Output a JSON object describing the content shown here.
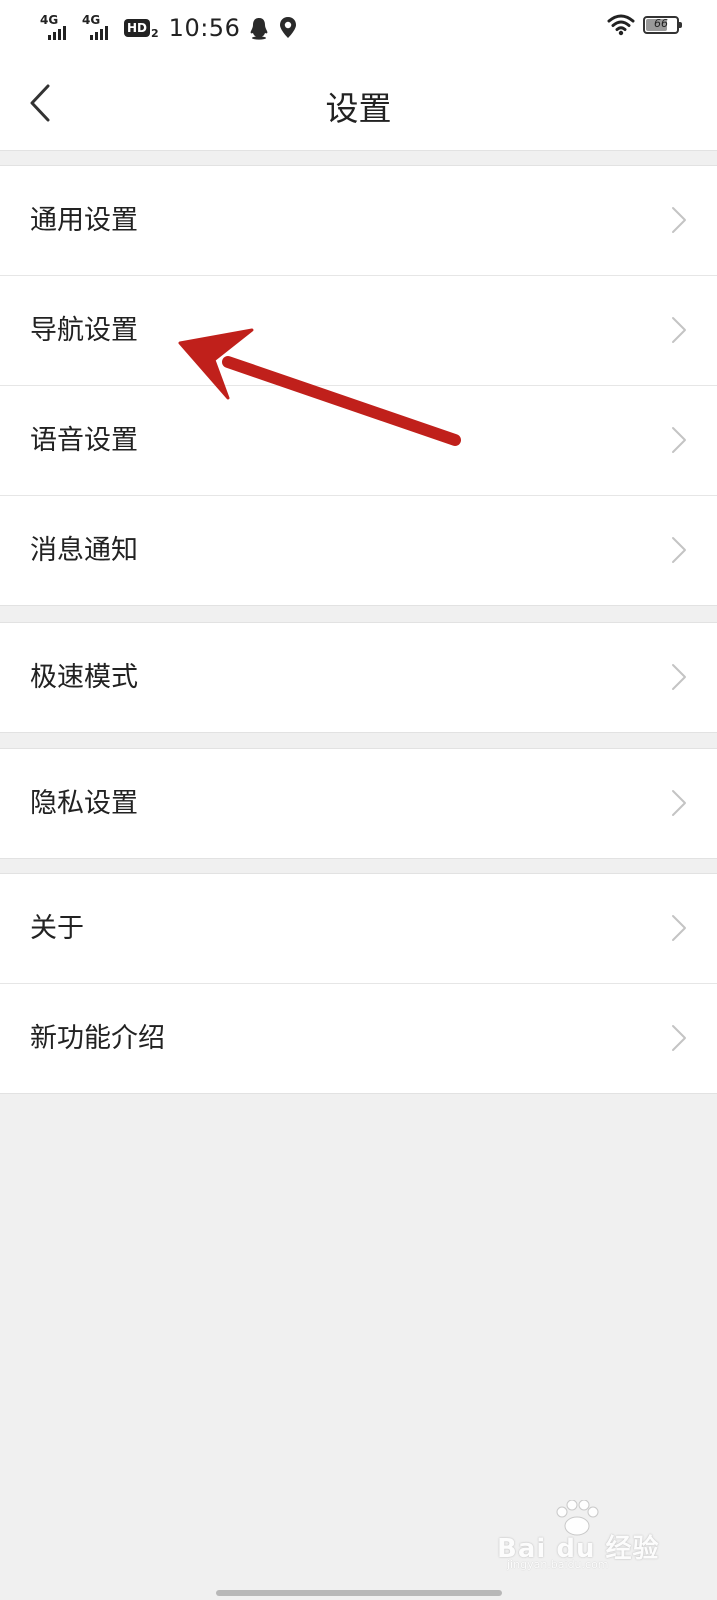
{
  "status_bar": {
    "signal1_label": "4G",
    "signal2_label": "4G",
    "hd_label": "HD",
    "hd_sub": "2",
    "time": "10:56",
    "battery_level": "66"
  },
  "header": {
    "title": "设置"
  },
  "groups": [
    {
      "items": [
        "通用设置",
        "导航设置",
        "语音设置",
        "消息通知"
      ]
    },
    {
      "items": [
        "极速模式"
      ]
    },
    {
      "items": [
        "隐私设置"
      ]
    },
    {
      "items": [
        "关于",
        "新功能介绍"
      ]
    }
  ],
  "watermark": {
    "text": "Bai du 经验",
    "url": "jingyan.baidu.com"
  },
  "colors": {
    "annotation_arrow": "#c0201b",
    "chevron": "#c4c4c4",
    "background": "#f0f0f0"
  }
}
